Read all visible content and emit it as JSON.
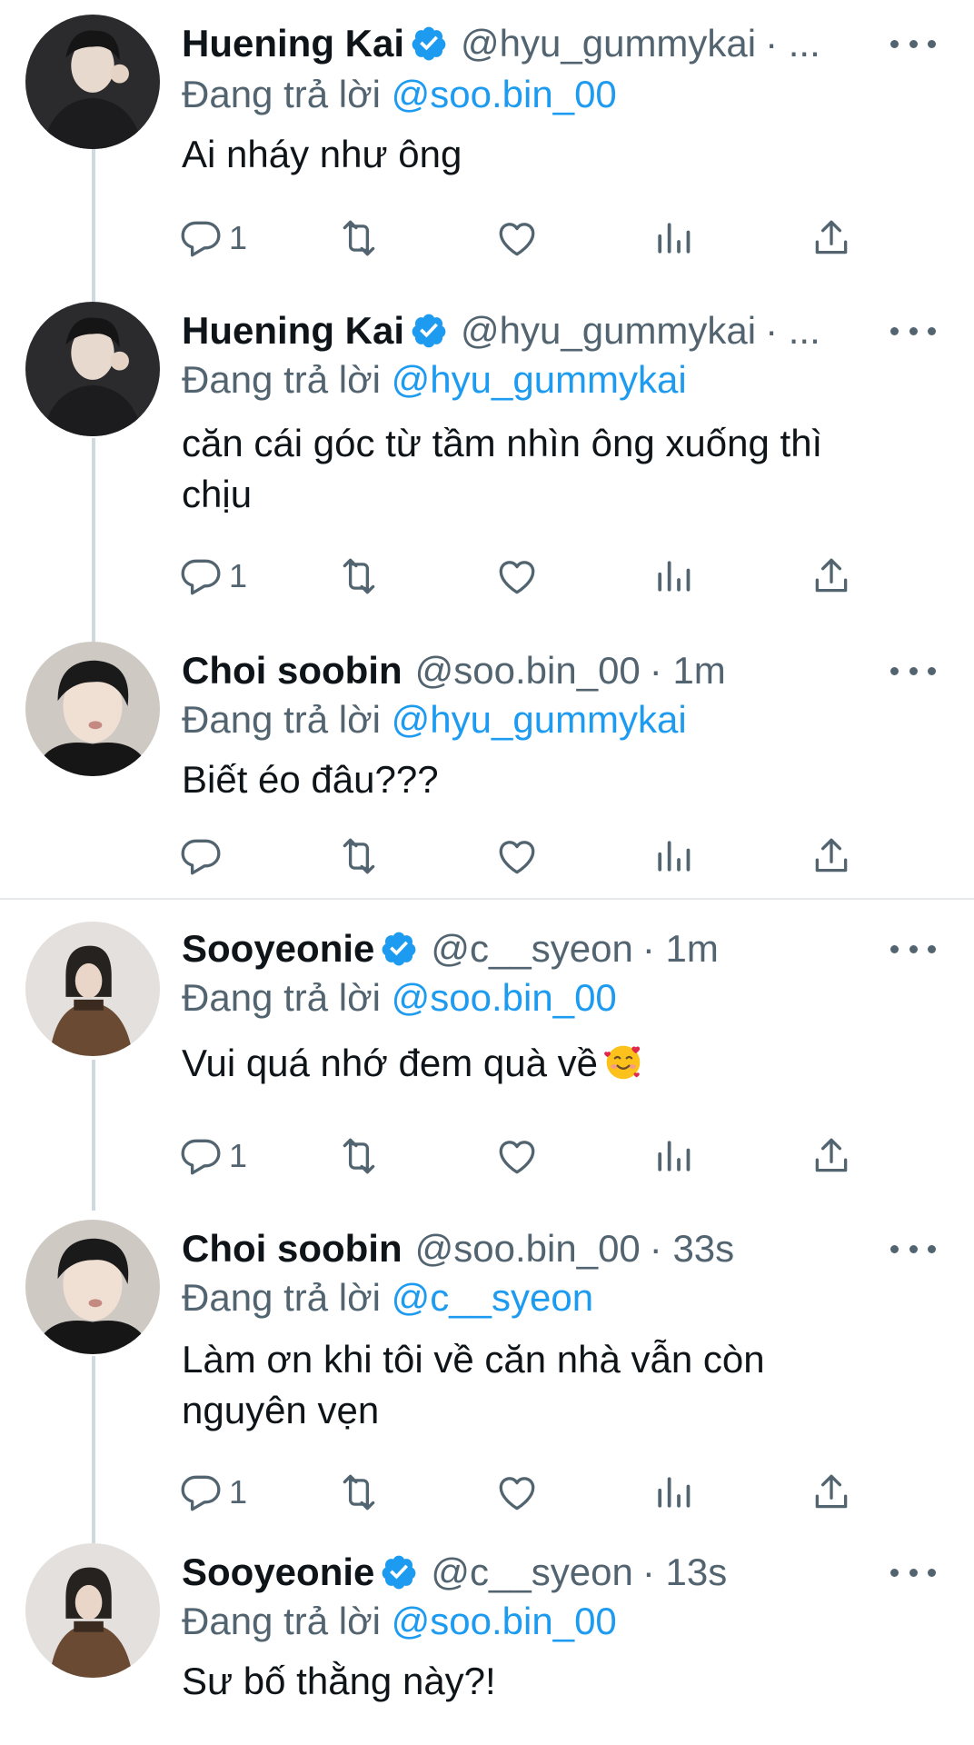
{
  "tweets": [
    {
      "name": "Huening Kai",
      "verified": true,
      "handle": "@hyu_gummykai",
      "time_suffix": "· ...",
      "reply_prefix": "Đang trả lời",
      "reply_to": "@soo.bin_00",
      "text": "Ai nháy như ông",
      "reply_count": "1",
      "avatar": "huening-kai-avatar"
    },
    {
      "name": "Huening Kai",
      "verified": true,
      "handle": "@hyu_gummykai",
      "time_suffix": "· ...",
      "reply_prefix": "Đang trả lời",
      "reply_to": "@hyu_gummykai",
      "text_line1": "căn cái góc từ tầm nhìn ông xuống thì",
      "text_line2": "chịu",
      "reply_count": "1",
      "avatar": "huening-kai-avatar"
    },
    {
      "name": "Choi soobin",
      "verified": false,
      "handle": "@soo.bin_00",
      "time": "· 1m",
      "reply_prefix": "Đang trả lời",
      "reply_to": "@hyu_gummykai",
      "text": "Biết éo đâu???",
      "reply_count": "",
      "avatar": "choi-soobin-avatar"
    },
    {
      "name": "Sooyeonie",
      "verified": true,
      "handle": "@c__syeon",
      "time": "· 1m",
      "reply_prefix": "Đang trả lời",
      "reply_to": "@soo.bin_00",
      "text": "Vui quá nhớ đem quà về",
      "emoji": "smiling-face-with-hearts",
      "reply_count": "1",
      "avatar": "sooyeonie-avatar"
    },
    {
      "name": "Choi soobin",
      "verified": false,
      "handle": "@soo.bin_00",
      "time": "· 33s",
      "reply_prefix": "Đang trả lời",
      "reply_to": "@c__syeon",
      "text_line1": "Làm ơn khi tôi về căn nhà vẫn còn",
      "text_line2": "nguyên vẹn",
      "reply_count": "1",
      "avatar": "choi-soobin-avatar"
    },
    {
      "name": "Sooyeonie",
      "verified": true,
      "handle": "@c__syeon",
      "time": "· 13s",
      "reply_prefix": "Đang trả lời",
      "reply_to": "@soo.bin_00",
      "text": "Sư bố thằng này?!",
      "avatar": "sooyeonie-avatar"
    }
  ],
  "colors": {
    "accent": "#1d9bf0",
    "secondary_text": "#536471",
    "primary_text": "#0f1419",
    "thread_line": "#cfd9de"
  }
}
